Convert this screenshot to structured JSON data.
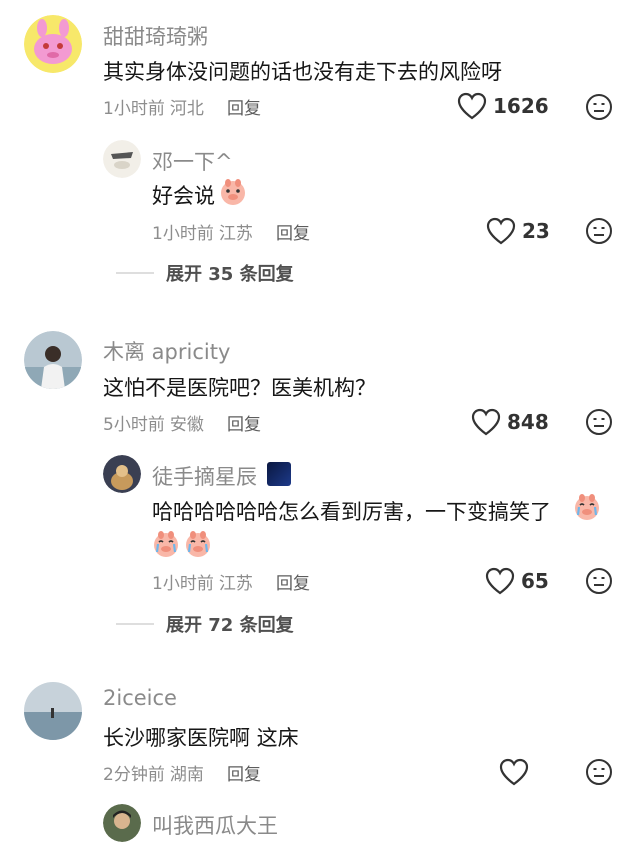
{
  "comments": [
    {
      "username": "甜甜琦琦粥",
      "text": "其实身体没问题的话也没有走下去的风险呀",
      "time": "1小时前",
      "location": "河北",
      "reply_label": "回复",
      "likes": "1626",
      "replies": [
        {
          "username": "邓一下^",
          "text": "好会说",
          "time": "1小时前",
          "location": "江苏",
          "reply_label": "回复",
          "likes": "23"
        }
      ],
      "expand_label": "展开 35 条回复"
    },
    {
      "username": "木离 apricity",
      "text": "这怕不是医院吧？医美机构？",
      "time": "5小时前",
      "location": "安徽",
      "reply_label": "回复",
      "likes": "848",
      "replies": [
        {
          "username": "徒手摘星辰",
          "text": "哈哈哈哈哈哈怎么看到厉害，一下变搞笑了",
          "time": "1小时前",
          "location": "江苏",
          "reply_label": "回复",
          "likes": "65"
        }
      ],
      "expand_label": "展开 72 条回复"
    },
    {
      "username": "2iceice",
      "text": "长沙哪家医院啊 这床",
      "time": "2分钟前",
      "location": "湖南",
      "reply_label": "回复",
      "likes": ""
    },
    {
      "username": "叫我西瓜大王"
    }
  ],
  "icons": {
    "like": "heart-outline-icon",
    "dislike": "dislike-face-icon",
    "emoji": "crying-pig-emoji"
  },
  "colors": {
    "text": "#161616",
    "name": "#8a8a8a",
    "meta": "#8d8d8d"
  }
}
